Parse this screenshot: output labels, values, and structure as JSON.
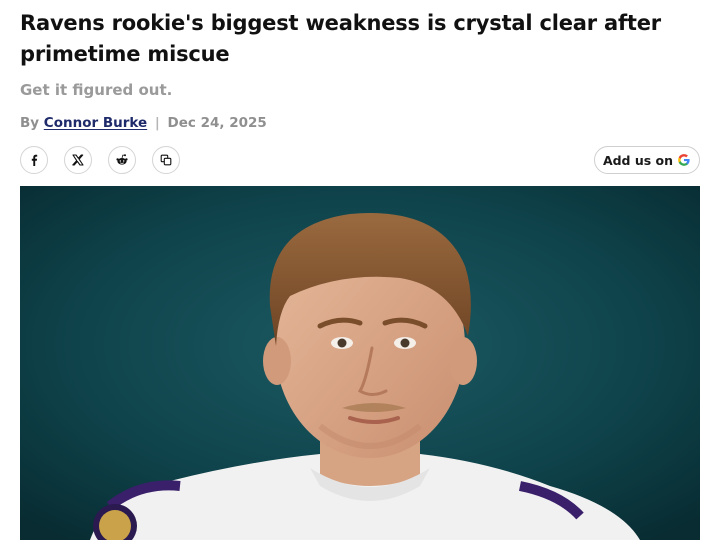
{
  "article": {
    "headline": "Ravens rookie's biggest weakness is crystal clear after primetime miscue",
    "subtitle": "Get it figured out.",
    "byline": {
      "prefix": "By",
      "author": "Connor Burke",
      "separator": "|",
      "date": "Dec 24, 2025"
    }
  },
  "share": {
    "icons": [
      "facebook-icon",
      "x-icon",
      "reddit-icon",
      "copy-link-icon"
    ],
    "add_google_label": "Add us on"
  },
  "hero_image": {
    "subject": "football-player-photo",
    "background_color": "#0c3b42",
    "jersey_color": "#f2f2f2",
    "trim_color": "#3a1f6b"
  }
}
